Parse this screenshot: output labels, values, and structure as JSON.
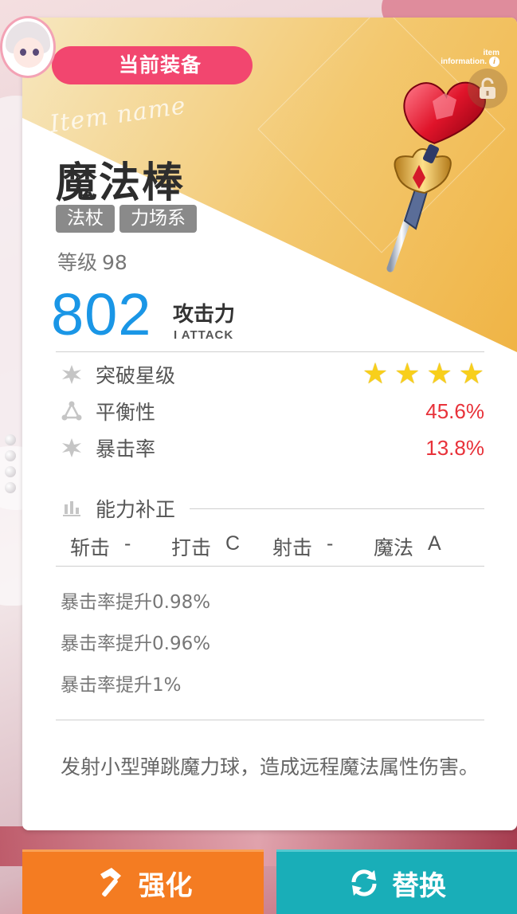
{
  "header": {
    "badge_label": "当前装备",
    "item_info_line1": "item",
    "item_info_line2": "information.",
    "info_icon": "i"
  },
  "item": {
    "watermark": "Item name",
    "name": "魔法棒",
    "tags": [
      "法杖",
      "力场系"
    ],
    "level_label": "等级",
    "level_value": "98",
    "attack_value": "802",
    "attack_label": "攻击力",
    "attack_sub": "I ATTACK"
  },
  "stats": {
    "breakthrough_label": "突破星级",
    "breakthrough_stars": 4,
    "balance_label": "平衡性",
    "balance_value": "45.6%",
    "crit_label": "暴击率",
    "crit_value": "13.8%",
    "value_color": "#e8323a"
  },
  "ability": {
    "header": "能力补正",
    "items": [
      {
        "name": "斩击",
        "grade": "-"
      },
      {
        "name": "打击",
        "grade": "C"
      },
      {
        "name": "射击",
        "grade": "-"
      },
      {
        "name": "魔法",
        "grade": "A"
      }
    ]
  },
  "bonuses": [
    "暴击率提升0.98%",
    "暴击率提升0.96%",
    "暴击率提升1%"
  ],
  "description": "发射小型弹跳魔力球，造成远程魔法属性伤害。",
  "buttons": {
    "upgrade_label": "强化",
    "replace_label": "替换",
    "upgrade_color": "#f47c22",
    "replace_color": "#19aeb8"
  },
  "icons": {
    "upgrade": "hammer-icon",
    "replace": "refresh-icon",
    "lock": "unlock-icon",
    "breakthrough": "star-burst-icon",
    "balance": "triangle-nodes-icon",
    "crit": "star-burst-icon",
    "ability": "bar-chart-icon"
  }
}
